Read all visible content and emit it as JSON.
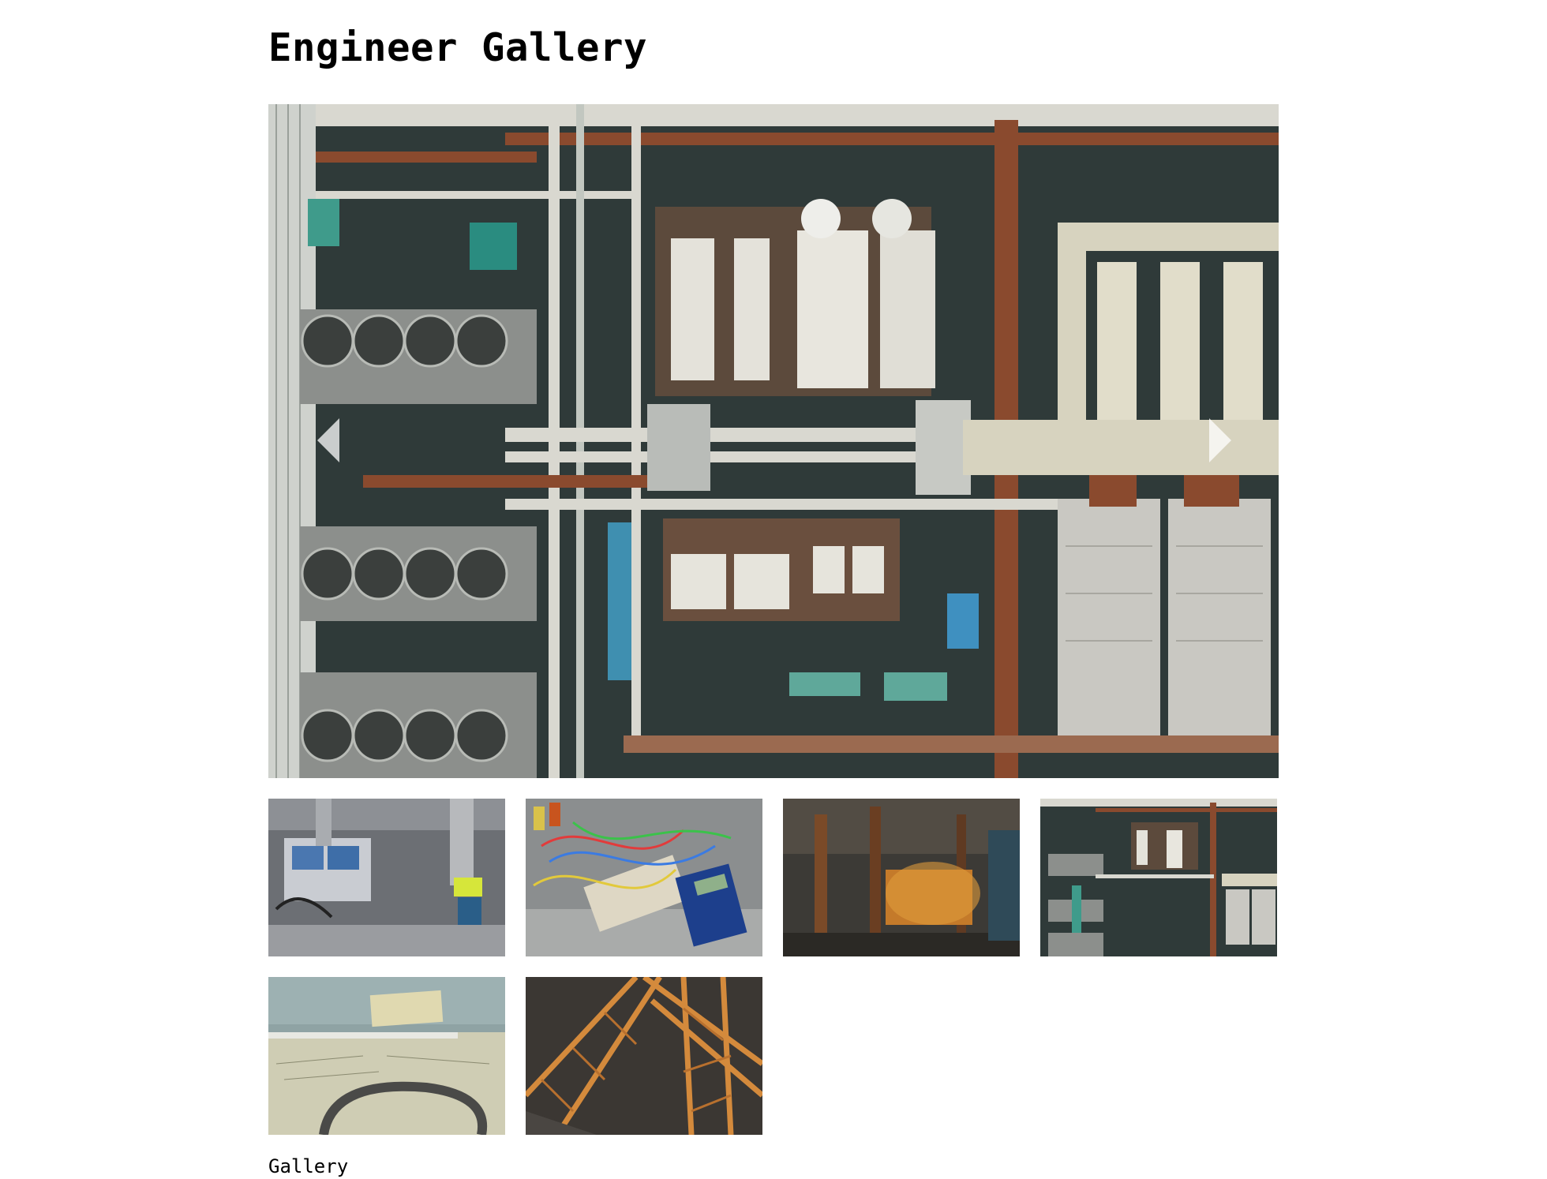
{
  "page": {
    "title": "Engineer Gallery",
    "caption": "Gallery"
  },
  "viewer": {
    "current_image": "rooftop-pipes-aerial",
    "prev_icon": "chevron-left-icon",
    "next_icon": "chevron-right-icon"
  },
  "thumbnails": [
    {
      "image": "robotic-machinery"
    },
    {
      "image": "breadboard-multimeter"
    },
    {
      "image": "steel-mill-interior"
    },
    {
      "image": "rooftop-pipes-aerial"
    },
    {
      "image": "blueprint-drawings"
    },
    {
      "image": "steel-truss-structure"
    }
  ],
  "colors": {
    "rust": "#8a4a2e",
    "pipe_white": "#d9d8d0",
    "roof_dark": "#2f3a39",
    "teal": "#3f9b8b"
  }
}
